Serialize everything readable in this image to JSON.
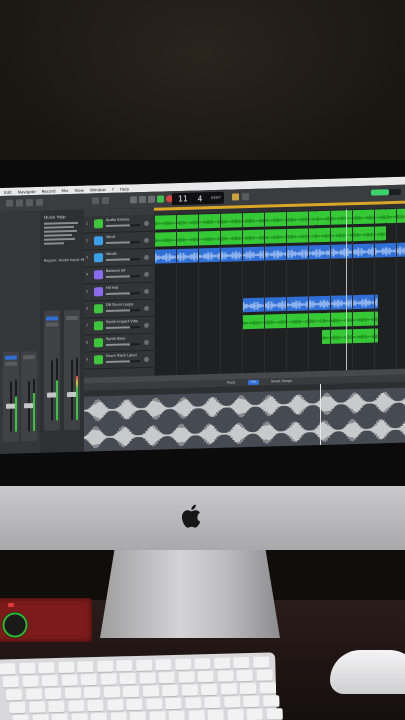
{
  "menubar": {
    "items": [
      "Edit",
      "Navigate",
      "Record",
      "Mix",
      "View",
      "Window",
      "?",
      "Help"
    ],
    "status": ""
  },
  "control_bar": {
    "lcd_bar": "11",
    "lcd_beat": "4",
    "lcd_small": "KEEP",
    "cpu_fraction": 0.6
  },
  "quick_help": {
    "title": "Quick Help",
    "region_label": "Region: Audio Input 4B"
  },
  "tracks": [
    {
      "name": "Audio Grease",
      "icon_color": "#3dc63d"
    },
    {
      "name": "Vocal",
      "icon_color": "#3aa0e8"
    },
    {
      "name": "Vocals",
      "icon_color": "#3aa0e8"
    },
    {
      "name": "Balance kit",
      "icon_color": "#8b6cf0"
    },
    {
      "name": "Hif Hat",
      "icon_color": "#8b6cf0"
    },
    {
      "name": "DR Drum Loops",
      "icon_color": "#3dc63d"
    },
    {
      "name": "Synth Impact Vibe",
      "icon_color": "#3dc63d"
    },
    {
      "name": "Synth Bass",
      "icon_color": "#3dc63d"
    },
    {
      "name": "Drum Track Label",
      "icon_color": "#3dc63d"
    }
  ],
  "editor": {
    "tabs": [
      "Track",
      "File",
      "Smart Tempo"
    ]
  },
  "colors": {
    "midi_region": "#36c936",
    "audio_region": "#2f6fd6",
    "cycle": "#d9a629",
    "wave_bg": "#464b53"
  }
}
